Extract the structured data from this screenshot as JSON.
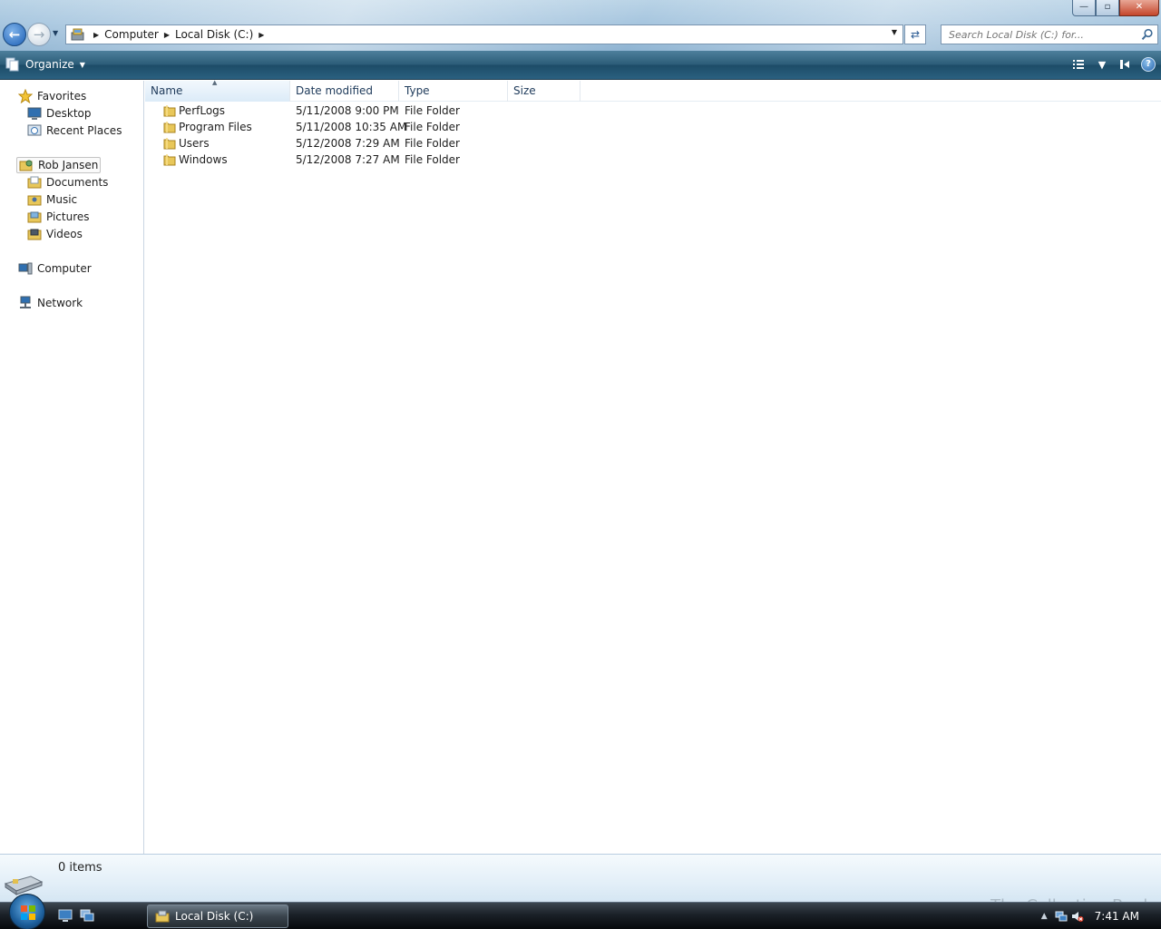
{
  "window": {
    "minimize_label": "—",
    "maximize_label": "▫",
    "close_label": "✕"
  },
  "address": {
    "crumbs": [
      "Computer",
      "Local Disk (C:)"
    ],
    "search_placeholder": "Search Local Disk (C:) for..."
  },
  "commandbar": {
    "organize_label": "Organize"
  },
  "navpane": {
    "favorites": "Favorites",
    "desktop": "Desktop",
    "recent_places": "Recent Places",
    "user": "Rob Jansen",
    "documents": "Documents",
    "music": "Music",
    "pictures": "Pictures",
    "videos": "Videos",
    "computer": "Computer",
    "network": "Network"
  },
  "filelist": {
    "columns": {
      "name": "Name",
      "date": "Date modified",
      "type": "Type",
      "size": "Size"
    },
    "rows": [
      {
        "name": "PerfLogs",
        "date": "5/11/2008 9:00 PM",
        "type": "File Folder"
      },
      {
        "name": "Program Files",
        "date": "5/11/2008 10:35 AM",
        "type": "File Folder"
      },
      {
        "name": "Users",
        "date": "5/12/2008 7:29 AM",
        "type": "File Folder"
      },
      {
        "name": "Windows",
        "date": "5/12/2008 7:27 AM",
        "type": "File Folder"
      }
    ]
  },
  "details": {
    "item_count": "0 items",
    "watermark": "The Collection Book"
  },
  "taskbar": {
    "task_label": "Local Disk (C:)",
    "clock": "7:41 AM"
  },
  "colors": {
    "command_bar": "#2c5d78",
    "accent_blue": "#1c5fb5",
    "taskbar": "#1b2128"
  }
}
